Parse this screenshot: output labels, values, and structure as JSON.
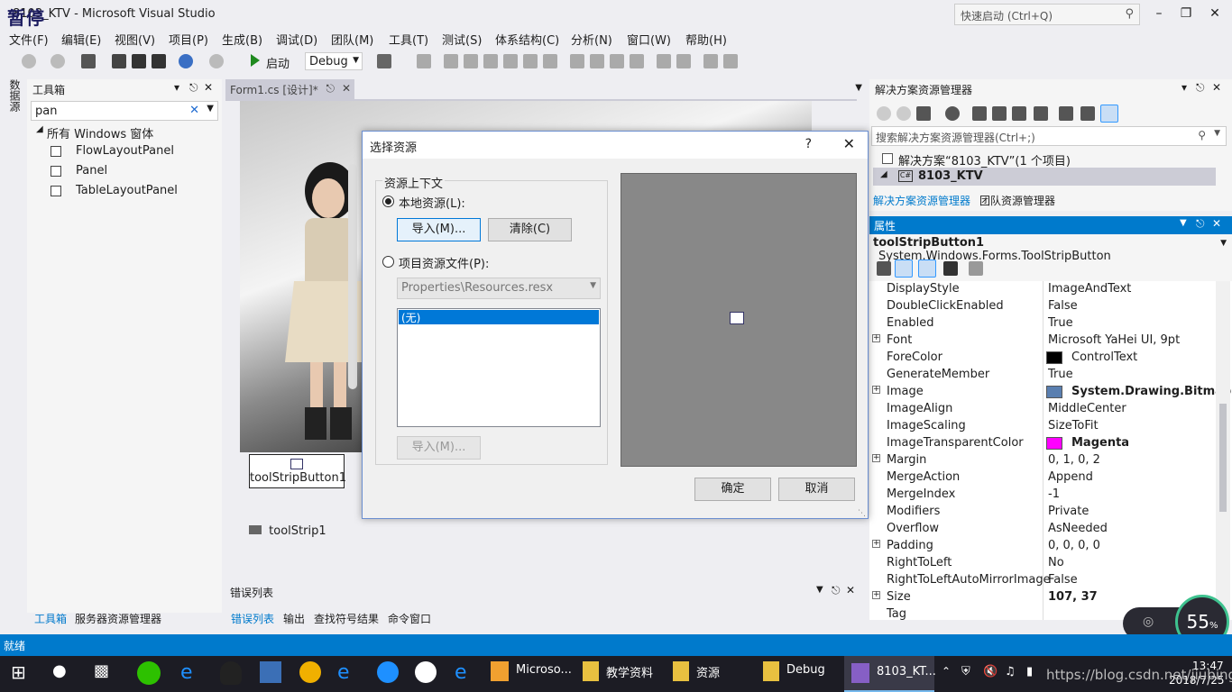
{
  "window": {
    "title": "8103_KTV - Microsoft Visual Studio",
    "paused_badge": "暂停",
    "quick_launch_placeholder": "快速启动 (Ctrl+Q)"
  },
  "menu": [
    "文件(F)",
    "编辑(E)",
    "视图(V)",
    "项目(P)",
    "生成(B)",
    "调试(D)",
    "团队(M)",
    "工具(T)",
    "测试(S)",
    "体系结构(C)",
    "分析(N)",
    "窗口(W)",
    "帮助(H)"
  ],
  "toolbar": {
    "start_label": "启动",
    "config_value": "Debug"
  },
  "left_strip": {
    "label": "数据源"
  },
  "toolbox": {
    "title": "工具箱",
    "search_value": "pan",
    "group": "所有 Windows 窗体",
    "items": [
      "FlowLayoutPanel",
      "Panel",
      "TableLayoutPanel"
    ],
    "bottom_tabs": [
      "工具箱",
      "服务器资源管理器"
    ]
  },
  "document": {
    "tab_label": "Form1.cs [设计]*",
    "toolstrip_button_label": "toolStripButton1",
    "component_tray_label": "toolStrip1"
  },
  "error_panel": {
    "title": "错误列表",
    "tabs": [
      "错误列表",
      "输出",
      "查找符号结果",
      "命令窗口"
    ]
  },
  "solution_explorer": {
    "title": "解决方案资源管理器",
    "search_placeholder": "搜索解决方案资源管理器(Ctrl+;)",
    "solution_node": "解决方案“8103_KTV”(1 个项目)",
    "project_node": "8103_KTV",
    "tabs": [
      "解决方案资源管理器",
      "团队资源管理器"
    ]
  },
  "properties": {
    "title": "属性",
    "object_name": "toolStripButton1",
    "object_type": "System.Windows.Forms.ToolStripButton",
    "rows": [
      {
        "name": "DisplayStyle",
        "value": "ImageAndText"
      },
      {
        "name": "DoubleClickEnabled",
        "value": "False"
      },
      {
        "name": "Enabled",
        "value": "True"
      },
      {
        "name": "Font",
        "value": "Microsoft YaHei UI, 9pt"
      },
      {
        "name": "ForeColor",
        "value": "ControlText"
      },
      {
        "name": "GenerateMember",
        "value": "True"
      },
      {
        "name": "Image",
        "value": "System.Drawing.Bitmap"
      },
      {
        "name": "ImageAlign",
        "value": "MiddleCenter"
      },
      {
        "name": "ImageScaling",
        "value": "SizeToFit"
      },
      {
        "name": "ImageTransparentColor",
        "value": "Magenta"
      },
      {
        "name": "Margin",
        "value": "0, 1, 0, 2"
      },
      {
        "name": "MergeAction",
        "value": "Append"
      },
      {
        "name": "MergeIndex",
        "value": "-1"
      },
      {
        "name": "Modifiers",
        "value": "Private"
      },
      {
        "name": "Overflow",
        "value": "AsNeeded"
      },
      {
        "name": "Padding",
        "value": "0, 0, 0, 0"
      },
      {
        "name": "RightToLeft",
        "value": "No"
      },
      {
        "name": "RightToLeftAutoMirrorImage",
        "value": "False"
      },
      {
        "name": "Size",
        "value": "107, 37"
      },
      {
        "name": "Tag",
        "value": ""
      }
    ]
  },
  "dialog": {
    "title": "选择资源",
    "help_glyph": "?",
    "group_label": "资源上下文",
    "local_resource_label": "本地资源(L):",
    "import_button": "导入(M)...",
    "clear_button": "清除(C)",
    "project_resource_label": "项目资源文件(P):",
    "resx_combo_value": "Properties\\Resources.resx",
    "list_selected": "(无)",
    "import_button_2": "导入(M)...",
    "ok_button": "确定",
    "cancel_button": "取消"
  },
  "status": {
    "text": "就绪"
  },
  "taskbar": {
    "apps": [
      "Microso...",
      "教学资料",
      "资源",
      "Debug",
      "8103_KT..."
    ],
    "time": "13:47",
    "date": "2018/7/25"
  },
  "monitor": {
    "percent": "55",
    "unit": "%"
  },
  "watermark": "https://blog.csdn.net/jiubing",
  "colors": {
    "accent": "#007acc",
    "taskbar": "#1c1c24",
    "magenta": "#ff00ff"
  }
}
